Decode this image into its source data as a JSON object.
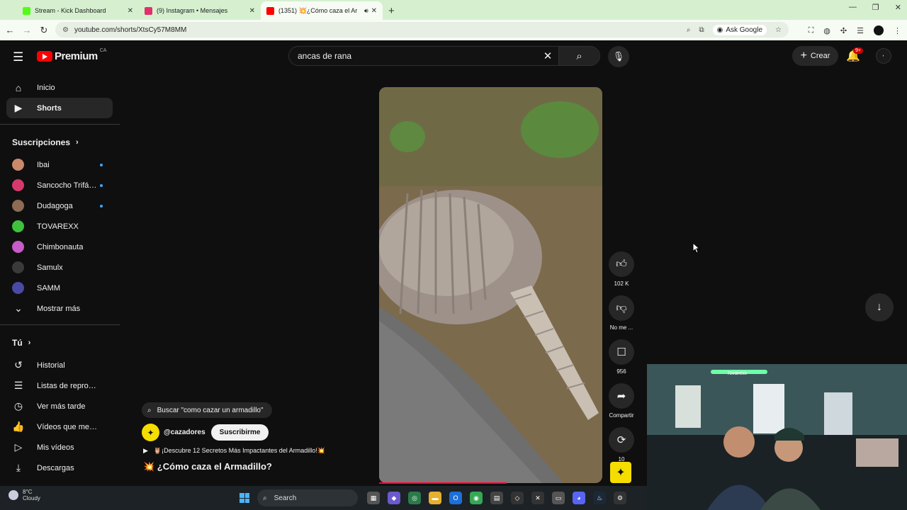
{
  "browser": {
    "tabs": [
      {
        "title": "Stream - Kick Dashboard",
        "color": "#53fc18",
        "active": false
      },
      {
        "title": "(9) Instagram • Mensajes",
        "color": "#e1306c",
        "active": false
      },
      {
        "title": "(1351) 💥¿Cómo caza el Ar",
        "color": "#ff0000",
        "active": true
      }
    ],
    "new_tab": "+",
    "url": "youtube.com/shorts/XtsCy57M8MM",
    "ask_google": "Ask Google"
  },
  "youtube": {
    "logo_text": "Premium",
    "country": "CA",
    "search_query": "ancas de rana",
    "create_label": "Crear",
    "notif_badge": "9+",
    "sidebar": {
      "main": [
        {
          "label": "Inicio",
          "icon": "home-icon",
          "glyph": "⌂"
        },
        {
          "label": "Shorts",
          "icon": "shorts-icon",
          "glyph": "▶",
          "selected": true
        }
      ],
      "subs_header": "Suscripciones",
      "subs": [
        {
          "label": "Ibai",
          "color": "#c98a6c",
          "dot": true
        },
        {
          "label": "Sancocho Trifásico",
          "color": "#d63a6b",
          "dot": true
        },
        {
          "label": "Dudagoga",
          "color": "#8d6b55",
          "dot": true
        },
        {
          "label": "TOVAREXX",
          "color": "#3ec23e",
          "dot": false
        },
        {
          "label": "Chimbonauta",
          "color": "#c75bc7",
          "dot": false
        },
        {
          "label": "Samulx",
          "color": "#3a3a3a",
          "dot": false
        },
        {
          "label": "SAMM",
          "color": "#4a4aa6",
          "dot": false
        }
      ],
      "show_more": "Mostrar más",
      "you_header": "Tú",
      "you": [
        {
          "label": "Historial",
          "glyph": "↺"
        },
        {
          "label": "Listas de reproducción",
          "glyph": "☰"
        },
        {
          "label": "Ver más tarde",
          "glyph": "◷"
        },
        {
          "label": "Vídeos que me gustan",
          "glyph": "👍"
        },
        {
          "label": "Mis vídeos",
          "glyph": "▷"
        },
        {
          "label": "Descargas",
          "glyph": "⤓"
        }
      ]
    },
    "short": {
      "likes": "102 K",
      "dislike_label": "No me ...",
      "comments": "956",
      "share_label": "Compartir",
      "remix_count": "10",
      "related_search": "Buscar \"como cazar un armadillo\"",
      "channel": "@cazadores",
      "subscribe_label": "Suscribirme",
      "music_text": "🦉¡Descubre 12 Secretos Más Impactantes del Armadillo!💥",
      "title": "💥 ¿Cómo caza el Armadillo?",
      "progress": 0.57
    }
  },
  "taskbar": {
    "temp": "8°C",
    "weather": "Cloudy",
    "search": "Search"
  },
  "webcam": {
    "sign": "Tovarexx"
  }
}
